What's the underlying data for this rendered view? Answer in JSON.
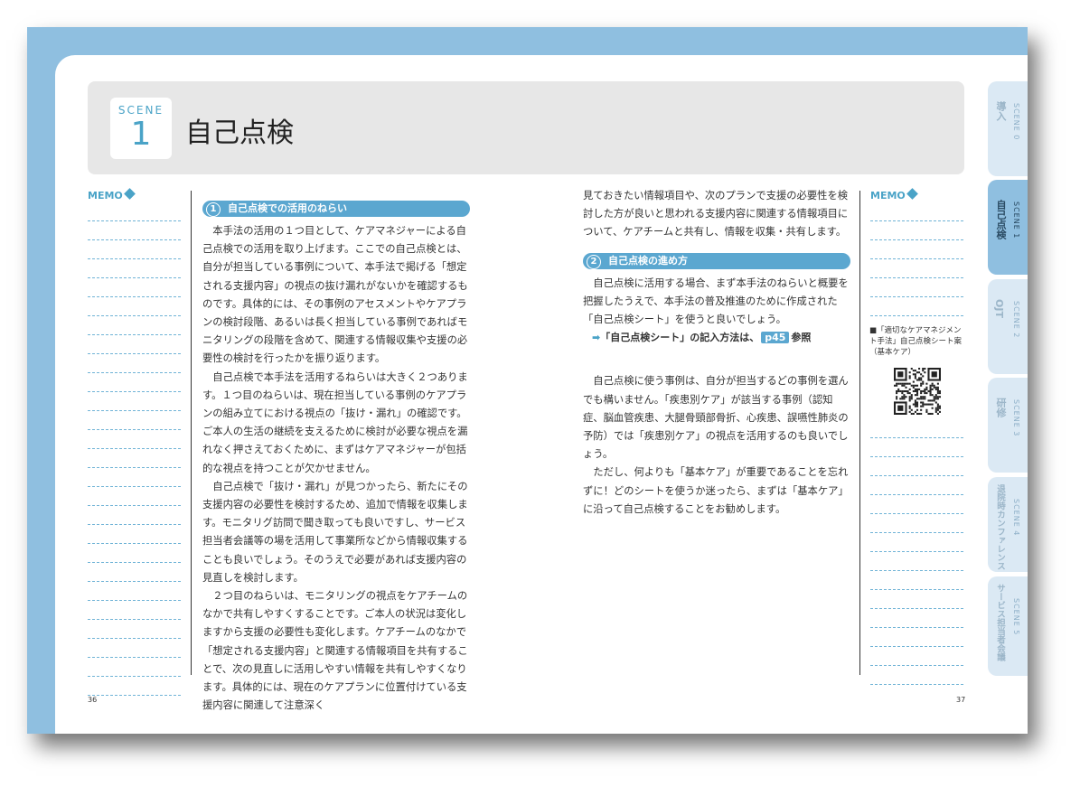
{
  "header": {
    "scene_word": "SCENE",
    "scene_number": "1",
    "title": "自己点検"
  },
  "memo_label": "MEMO",
  "section1": {
    "number": "1",
    "heading": "自己点検での活用のねらい",
    "paragraphs": [
      "本手法の活用の１つ目として、ケアマネジャーによる自己点検での活用を取り上げます。ここでの自己点検とは、自分が担当している事例について、本手法で掲げる「想定される支援内容」の視点の抜け漏れがないかを確認するものです。具体的には、その事例のアセスメントやケアプランの検討段階、あるいは長く担当している事例であればモニタリングの段階を含めて、関連する情報収集や支援の必要性の検討を行ったかを振り返ります。",
      "自己点検で本手法を活用するねらいは大きく２つあります。１つ目のねらいは、現在担当している事例のケアプランの組み立てにおける視点の「抜け・漏れ」の確認です。ご本人の生活の継続を支えるために検討が必要な視点を漏れなく押さえておくために、まずはケアマネジャーが包括的な視点を持つことが欠かせません。",
      "自己点検で「抜け・漏れ」が見つかったら、新たにその支援内容の必要性を検討するため、追加で情報を収集します。モニタリグ訪問で聞き取っても良いですし、サービス担当者会議等の場を活用して事業所などから情報収集することも良いでしょう。そのうえで必要があれば支援内容の見直しを検討します。",
      "２つ目のねらいは、モニタリングの視点をケアチームのなかで共有しやすくすることです。ご本人の状況は変化しますから支援の必要性も変化します。ケアチームのなかで「想定される支援内容」と関連する情報項目を共有することで、次の見直しに活用しやすい情報を共有しやすくなります。具体的には、現在のケアプランに位置付けている支援内容に関連して注意深く"
    ]
  },
  "right_column": {
    "continuation": "見ておきたい情報項目や、次のプランで支援の必要性を検討した方が良いと思われる支援内容に関連する情報項目について、ケアチームと共有し、情報を収集・共有します。",
    "section2": {
      "number": "2",
      "heading": "自己点検の進め方",
      "paragraph": "自己点検に活用する場合、まず本手法のねらいと概要を把握したうえで、本手法の普及推進のために作成された「自己点検シート」を使うと良いでしょう。"
    },
    "reference": {
      "arrow": "➡",
      "text": "「自己点検シート」の記入方法は、",
      "page": "p45",
      "suffix": "参照"
    },
    "paragraphs": [
      "自己点検に使う事例は、自分が担当するどの事例を選んでも構いません。「疾患別ケア」が該当する事例（認知症、脳血管疾患、大腿骨頸部骨折、心疾患、誤嚥性肺炎の予防）では「疾患別ケア」の視点を活用するのも良いでしょう。",
      "ただし、何よりも「基本ケア」が重要であることを忘れずに！どのシートを使うか迷ったら、まずは「基本ケア」に沿って自己点検することをお勧めします。"
    ]
  },
  "qr_note": "■「適切なケアマネジメント手法」自己点検シート案（基本ケア）",
  "page_numbers": {
    "left": "36",
    "right": "37"
  },
  "tabs": [
    {
      "scene": "SCENE 0",
      "label": "導入",
      "active": false
    },
    {
      "scene": "SCENE 1",
      "label": "自己点検",
      "active": true
    },
    {
      "scene": "SCENE 2",
      "label": "OJT",
      "active": false
    },
    {
      "scene": "SCENE 3",
      "label": "研修",
      "active": false
    },
    {
      "scene": "SCENE 4",
      "label": "退院時カンファレンス",
      "active": false
    },
    {
      "scene": "SCENE 5",
      "label": "サービス担当者会議",
      "active": false
    }
  ],
  "colors": {
    "accent": "#5ba7d0",
    "frame": "#8fbfe0",
    "tab": "#dbe9f4"
  }
}
